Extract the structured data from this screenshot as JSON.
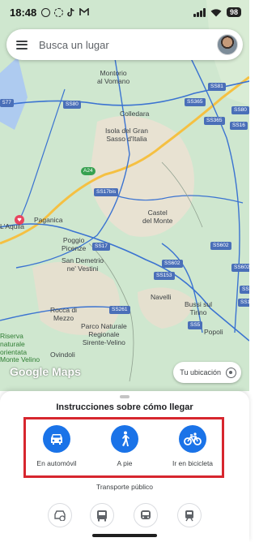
{
  "status_bar": {
    "time": "18:48",
    "battery": "98",
    "icons": [
      "whatsapp-icon",
      "sync-icon",
      "tiktok-icon",
      "gmail-icon",
      "signal-icon",
      "wifi-icon",
      "battery-icon"
    ]
  },
  "search": {
    "placeholder": "Busca un lugar"
  },
  "map": {
    "places": {
      "montorio": "Montorio\nal Vomano",
      "colledara": "Colledara",
      "isola": "Isola del Gran\nSasso d'Italia",
      "castel_del_monte": "Castel\ndel Monte",
      "paganica": "Paganica",
      "laquila": "L'Aquila",
      "poggio": "Poggio\nPicenze",
      "san_demetrio": "San Demetrio\nne' Vestini",
      "navelli": "Navelli",
      "bussi": "Bussi sul\nTirino",
      "popoli": "Popoli",
      "rocca": "Rocca di\nMezzo",
      "parco": "Parco Naturale\nRegionale\nSirente-Velino",
      "ovindoli": "Ovindoli",
      "riserva": "Riserva\nnaturale\norientata\nMonte Velino"
    },
    "roads": {
      "ss80": "SS80",
      "ss365a": "SS365",
      "ss81": "SS81",
      "ss365b": "SS365",
      "ss16": "SS16",
      "a24": "A24",
      "ss17bis": "SS17bis",
      "ss17a": "SS17",
      "ss602a": "SS602",
      "ss602b": "SS602",
      "ss153": "SS153",
      "ss261": "SS261",
      "ss5a": "SS5",
      "ss5b": "SS5",
      "ss17b": "SS17",
      "ss577": "577",
      "ss80b": "SS80",
      "ss602c": "SS602"
    },
    "google_logo": "Google Maps",
    "location_button": "Tu ubicación",
    "colors": {
      "land": "#cfe7cf",
      "highway": "#f5c042",
      "road": "#3b73d1",
      "pin": "#e8455f"
    }
  },
  "sheet": {
    "title": "Instrucciones sobre cómo llegar",
    "highlight_color": "#d7262e",
    "accent": "#1a73e8",
    "modes": [
      {
        "label": "En automóvil",
        "icon": "car-icon"
      },
      {
        "label": "A pie",
        "icon": "walking-icon"
      },
      {
        "label": "Ir en bicicleta",
        "icon": "bicycle-icon"
      }
    ],
    "transit_title": "Transporte público",
    "transit_icons": [
      "car-share-icon",
      "bus-icon",
      "bus-alt-icon",
      "train-icon"
    ]
  }
}
